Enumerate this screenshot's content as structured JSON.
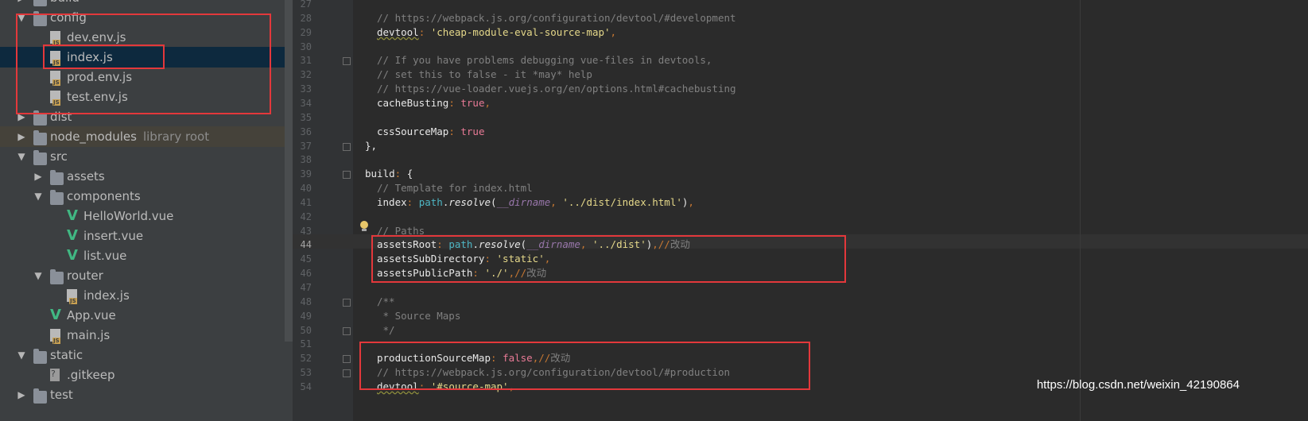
{
  "tree": {
    "items": [
      {
        "label": "build",
        "hint": "",
        "depth": 1,
        "arrow": "right",
        "icon": "folder-icon"
      },
      {
        "label": "config",
        "hint": "",
        "depth": 1,
        "arrow": "down",
        "icon": "folder-icon"
      },
      {
        "label": "dev.env.js",
        "hint": "",
        "depth": 2,
        "arrow": "",
        "icon": "js-file-icon"
      },
      {
        "label": "index.js",
        "hint": "",
        "depth": 2,
        "arrow": "",
        "icon": "js-file-icon",
        "selected": true
      },
      {
        "label": "prod.env.js",
        "hint": "",
        "depth": 2,
        "arrow": "",
        "icon": "js-file-icon"
      },
      {
        "label": "test.env.js",
        "hint": "",
        "depth": 2,
        "arrow": "",
        "icon": "js-file-icon"
      },
      {
        "label": "dist",
        "hint": "",
        "depth": 1,
        "arrow": "right",
        "icon": "folder-icon"
      },
      {
        "label": "node_modules",
        "hint": "library root",
        "depth": 1,
        "arrow": "right",
        "icon": "folder-icon",
        "library_root": true
      },
      {
        "label": "src",
        "hint": "",
        "depth": 1,
        "arrow": "down",
        "icon": "folder-icon"
      },
      {
        "label": "assets",
        "hint": "",
        "depth": 2,
        "arrow": "right",
        "icon": "folder-icon"
      },
      {
        "label": "components",
        "hint": "",
        "depth": 2,
        "arrow": "down",
        "icon": "folder-icon"
      },
      {
        "label": "HelloWorld.vue",
        "hint": "",
        "depth": 3,
        "arrow": "",
        "icon": "vue-file-icon"
      },
      {
        "label": "insert.vue",
        "hint": "",
        "depth": 3,
        "arrow": "",
        "icon": "vue-file-icon"
      },
      {
        "label": "list.vue",
        "hint": "",
        "depth": 3,
        "arrow": "",
        "icon": "vue-file-icon"
      },
      {
        "label": "router",
        "hint": "",
        "depth": 2,
        "arrow": "down",
        "icon": "folder-icon"
      },
      {
        "label": "index.js",
        "hint": "",
        "depth": 3,
        "arrow": "",
        "icon": "js-file-icon"
      },
      {
        "label": "App.vue",
        "hint": "",
        "depth": 2,
        "arrow": "",
        "icon": "vue-file-icon"
      },
      {
        "label": "main.js",
        "hint": "",
        "depth": 2,
        "arrow": "",
        "icon": "js-file-icon"
      },
      {
        "label": "static",
        "hint": "",
        "depth": 1,
        "arrow": "down",
        "icon": "folder-icon"
      },
      {
        "label": ".gitkeep",
        "hint": "",
        "depth": 2,
        "arrow": "",
        "icon": "unknown-file-icon"
      },
      {
        "label": "test",
        "hint": "",
        "depth": 1,
        "arrow": "right",
        "icon": "folder-icon"
      }
    ]
  },
  "editor": {
    "current_line": "44",
    "lines": [
      {
        "n": "27",
        "tokens": []
      },
      {
        "n": "28",
        "tokens": [
          {
            "t": "// https://webpack.js.org/configuration/devtool/#development",
            "c": "c-com"
          }
        ]
      },
      {
        "n": "29",
        "tokens": [
          {
            "t": "devtool",
            "c": "c-prop squig"
          },
          {
            "t": ": ",
            "c": "c-sep"
          },
          {
            "t": "'cheap-module-eval-source-map'",
            "c": "c-str"
          },
          {
            "t": ",",
            "c": "c-sep"
          }
        ]
      },
      {
        "n": "30",
        "tokens": []
      },
      {
        "n": "31",
        "tokens": [
          {
            "t": "// If you have problems debugging vue-files in devtools,",
            "c": "c-com"
          }
        ]
      },
      {
        "n": "32",
        "tokens": [
          {
            "t": "// set this to false - it *may* help",
            "c": "c-com"
          }
        ]
      },
      {
        "n": "33",
        "tokens": [
          {
            "t": "// https://vue-loader.vuejs.org/en/options.html#cachebusting",
            "c": "c-com"
          }
        ]
      },
      {
        "n": "34",
        "tokens": [
          {
            "t": "cacheBusting",
            "c": "c-prop"
          },
          {
            "t": ": ",
            "c": "c-sep"
          },
          {
            "t": "true",
            "c": "c-kw"
          },
          {
            "t": ",",
            "c": "c-sep"
          }
        ]
      },
      {
        "n": "35",
        "tokens": []
      },
      {
        "n": "36",
        "tokens": [
          {
            "t": "cssSourceMap",
            "c": "c-prop"
          },
          {
            "t": ": ",
            "c": "c-sep"
          },
          {
            "t": "true",
            "c": "c-kw"
          }
        ]
      },
      {
        "n": "37",
        "indent": "",
        "tokens": [
          {
            "t": "},",
            "c": "c-prop"
          }
        ]
      },
      {
        "n": "38",
        "tokens": []
      },
      {
        "n": "39",
        "indent": "",
        "tokens": [
          {
            "t": "build",
            "c": "c-prop"
          },
          {
            "t": ": ",
            "c": "c-sep"
          },
          {
            "t": "{",
            "c": "c-prop"
          }
        ]
      },
      {
        "n": "40",
        "tokens": [
          {
            "t": "// Template for index.html",
            "c": "c-com"
          }
        ]
      },
      {
        "n": "41",
        "tokens": [
          {
            "t": "index",
            "c": "c-prop"
          },
          {
            "t": ": ",
            "c": "c-sep"
          },
          {
            "t": "path",
            "c": "c-path"
          },
          {
            "t": ".",
            "c": "c-prop"
          },
          {
            "t": "resolve",
            "c": "c-fn"
          },
          {
            "t": "(",
            "c": "c-prop"
          },
          {
            "t": "__dirname",
            "c": "c-dir"
          },
          {
            "t": ", ",
            "c": "c-sep"
          },
          {
            "t": "'../dist/index.html'",
            "c": "c-str"
          },
          {
            "t": ")",
            "c": "c-prop"
          },
          {
            "t": ",",
            "c": "c-sep"
          }
        ]
      },
      {
        "n": "42",
        "tokens": []
      },
      {
        "n": "43",
        "tokens": [
          {
            "t": "// Paths",
            "c": "c-com"
          }
        ]
      },
      {
        "n": "44",
        "tokens": [
          {
            "t": "assetsRoot",
            "c": "c-prop"
          },
          {
            "t": ": ",
            "c": "c-sep"
          },
          {
            "t": "path",
            "c": "c-path"
          },
          {
            "t": ".",
            "c": "c-prop"
          },
          {
            "t": "resolve",
            "c": "c-fn"
          },
          {
            "t": "(",
            "c": "c-prop"
          },
          {
            "t": "__dirname",
            "c": "c-dir"
          },
          {
            "t": ", ",
            "c": "c-sep"
          },
          {
            "t": "'../dist'",
            "c": "c-str"
          },
          {
            "t": ")",
            "c": "c-prop"
          },
          {
            "t": ",//",
            "c": "c-sep"
          },
          {
            "t": "改动",
            "c": "c-zh"
          }
        ]
      },
      {
        "n": "45",
        "tokens": [
          {
            "t": "assetsSubDirectory",
            "c": "c-prop"
          },
          {
            "t": ": ",
            "c": "c-sep"
          },
          {
            "t": "'static'",
            "c": "c-str"
          },
          {
            "t": ",",
            "c": "c-sep"
          }
        ]
      },
      {
        "n": "46",
        "tokens": [
          {
            "t": "assetsPublicPath",
            "c": "c-prop"
          },
          {
            "t": ": ",
            "c": "c-sep"
          },
          {
            "t": "'./'",
            "c": "c-str"
          },
          {
            "t": ",//",
            "c": "c-sep"
          },
          {
            "t": "改动",
            "c": "c-zh"
          }
        ]
      },
      {
        "n": "47",
        "tokens": []
      },
      {
        "n": "48",
        "tokens": [
          {
            "t": "/**",
            "c": "c-com"
          }
        ]
      },
      {
        "n": "49",
        "tokens": [
          {
            "t": " * Source Maps",
            "c": "c-com"
          }
        ]
      },
      {
        "n": "50",
        "tokens": [
          {
            "t": " */",
            "c": "c-com"
          }
        ]
      },
      {
        "n": "51",
        "tokens": []
      },
      {
        "n": "52",
        "tokens": [
          {
            "t": "productionSourceMap",
            "c": "c-prop"
          },
          {
            "t": ": ",
            "c": "c-sep"
          },
          {
            "t": "false",
            "c": "c-kw"
          },
          {
            "t": ",//",
            "c": "c-sep"
          },
          {
            "t": "改动",
            "c": "c-zh"
          }
        ]
      },
      {
        "n": "53",
        "tokens": [
          {
            "t": "// https://webpack.js.org/configuration/devtool/#production",
            "c": "c-com"
          }
        ]
      },
      {
        "n": "54",
        "tokens": [
          {
            "t": "devtool",
            "c": "c-prop squig"
          },
          {
            "t": ": ",
            "c": "c-sep"
          },
          {
            "t": "'#source-map'",
            "c": "c-str"
          },
          {
            "t": ",",
            "c": "c-sep"
          }
        ]
      }
    ]
  },
  "watermark": "https://blog.csdn.net/weixin_42190864",
  "colors": {
    "annotation_box": "#e3383b",
    "selection": "#0d293e"
  }
}
